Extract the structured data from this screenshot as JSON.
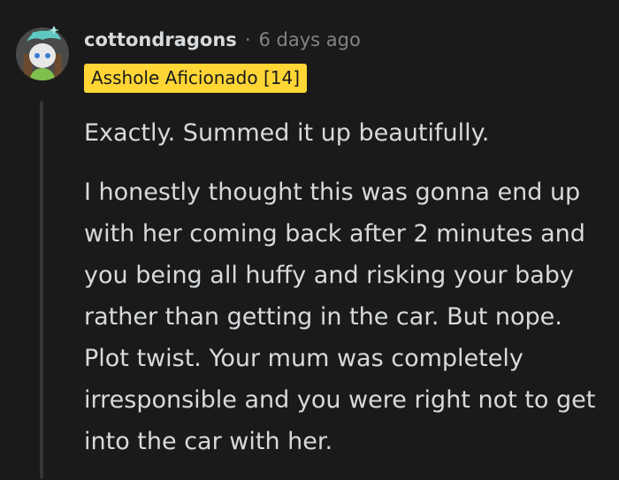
{
  "comment": {
    "author": "cottondragons",
    "separator": "·",
    "timestamp": "6 days ago",
    "flair": "Asshole Aficionado [14]",
    "paragraphs": [
      "Exactly. Summed it up beautifully.",
      "I honestly thought this was gonna end up with her coming back after 2 minutes and you being all huffy and risking your baby rather than getting in the car. But nope. Plot twist. Your mum was completely irresponsible and you were right not to get into the car with her."
    ]
  },
  "colors": {
    "background": "#1a1a1b",
    "text": "#d7dadc",
    "muted": "#818384",
    "flair_bg": "#ffd635",
    "flair_text": "#1a1a1b",
    "thread_line": "#343536"
  },
  "icons": {
    "avatar": "snoo-avatar-icon"
  }
}
